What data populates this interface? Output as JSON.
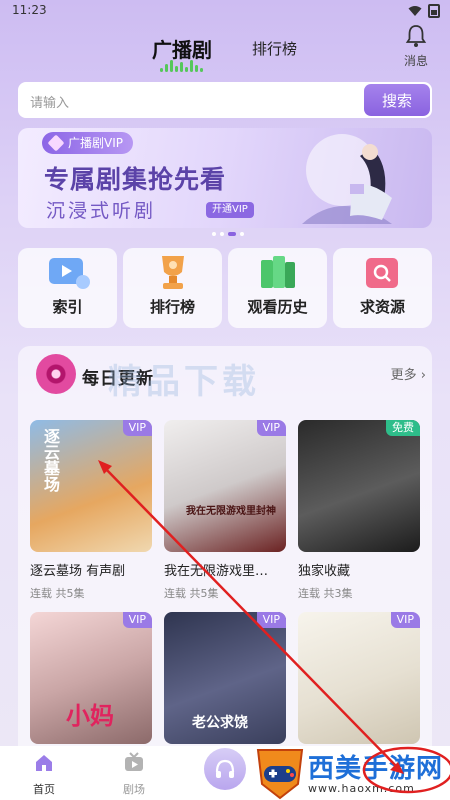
{
  "status": {
    "time": "11:23"
  },
  "header": {
    "tab_active": "广播剧",
    "tab_other": "排行榜",
    "message_label": "消息"
  },
  "search": {
    "placeholder": "请输入",
    "button": "搜索"
  },
  "banner": {
    "tag": "广播剧VIP",
    "title": "专属剧集抢先看",
    "subtitle": "沉浸式听剧",
    "open_label": "开通VIP"
  },
  "quick": [
    {
      "label": "索引",
      "icon": "index-icon",
      "color": "#6fa8f5"
    },
    {
      "label": "排行榜",
      "icon": "trophy-icon",
      "color": "#f2a24a"
    },
    {
      "label": "观看历史",
      "icon": "history-icon",
      "color": "#4cc66b"
    },
    {
      "label": "求资源",
      "icon": "search-resource-icon",
      "color": "#f06a8a"
    }
  ],
  "daily": {
    "title": "每日更新",
    "more": "更多",
    "watermark": "精品下载",
    "items": [
      {
        "title": "逐云墓场 有声剧",
        "meta": "连载 共5集",
        "badge": "VIP",
        "cover_text": "逐云墓场"
      },
      {
        "title": "我在无限游戏里…",
        "meta": "连载 共5集",
        "badge": "VIP",
        "cover_text": "我在无限游戏里封神"
      },
      {
        "title": "独家收藏",
        "meta": "连载 共3集",
        "badge": "免费",
        "cover_text": ""
      },
      {
        "title": "",
        "meta": "",
        "badge": "VIP",
        "cover_text": "小妈"
      },
      {
        "title": "",
        "meta": "",
        "badge": "VIP",
        "cover_text": "老公求饶"
      },
      {
        "title": "",
        "meta": "",
        "badge": "VIP",
        "cover_text": ""
      }
    ]
  },
  "nav": {
    "home": "首页",
    "theater": "剧场"
  },
  "logo": {
    "text": "西美手游网",
    "url": "www.haoxm.com"
  },
  "colors": {
    "accent": "#8a63e0",
    "arrow": "#e02020"
  }
}
